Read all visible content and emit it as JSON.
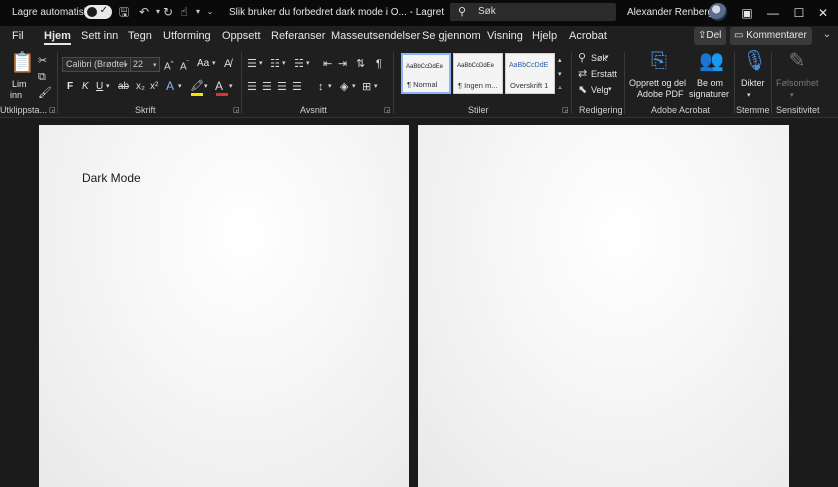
{
  "titlebar": {
    "autosave_label": "Lagre automatisk",
    "autosave_state": "on",
    "doc_title": "Slik bruker du forbedret dark mode i O... - Lagret",
    "search_placeholder": "Søk",
    "user_name": "Alexander Renberg"
  },
  "menubar": {
    "tabs": [
      "Fil",
      "Hjem",
      "Sett inn",
      "Tegn",
      "Utforming",
      "Oppsett",
      "Referanser",
      "Masseutsendelser",
      "Se gjennom",
      "Visning",
      "Hjelp",
      "Acrobat"
    ],
    "active_tab": "Hjem",
    "share_label": "Del",
    "comment_label": "Kommentarer"
  },
  "ribbon": {
    "clipboard": {
      "paste_label_1": "Lim",
      "paste_label_2": "inn",
      "group_label": "Utklippsta..."
    },
    "font": {
      "font_name": "Calibri (Brødtel",
      "font_size": "22",
      "group_label": "Skrift",
      "bold": "F",
      "italic": "K",
      "underline": "U",
      "grow": "A",
      "case": "Aa"
    },
    "paragraph": {
      "group_label": "Avsnitt"
    },
    "styles": {
      "group_label": "Stiler",
      "tiles": [
        {
          "preview": "AaBbCcDdEe",
          "name": "¶ Normal"
        },
        {
          "preview": "AaBbCcDdEe",
          "name": "¶ Ingen m..."
        },
        {
          "preview": "AaBbCcDdE",
          "name": "Overskrift 1"
        }
      ]
    },
    "editing": {
      "group_label": "Redigering",
      "find": "Søk",
      "replace": "Erstatt",
      "select": "Velg"
    },
    "acrobat": {
      "group_label": "Adobe Acrobat",
      "create_pdf_1": "Opprett og del",
      "create_pdf_2": "Adobe PDF",
      "request_sig_1": "Be om",
      "request_sig_2": "signaturer"
    },
    "voice": {
      "group_label": "Stemme",
      "dictate": "Dikter"
    },
    "sensitivity": {
      "group_label": "Sensitivitet",
      "label": "Følsomhet"
    }
  },
  "document": {
    "page1_text": "Dark Mode"
  }
}
